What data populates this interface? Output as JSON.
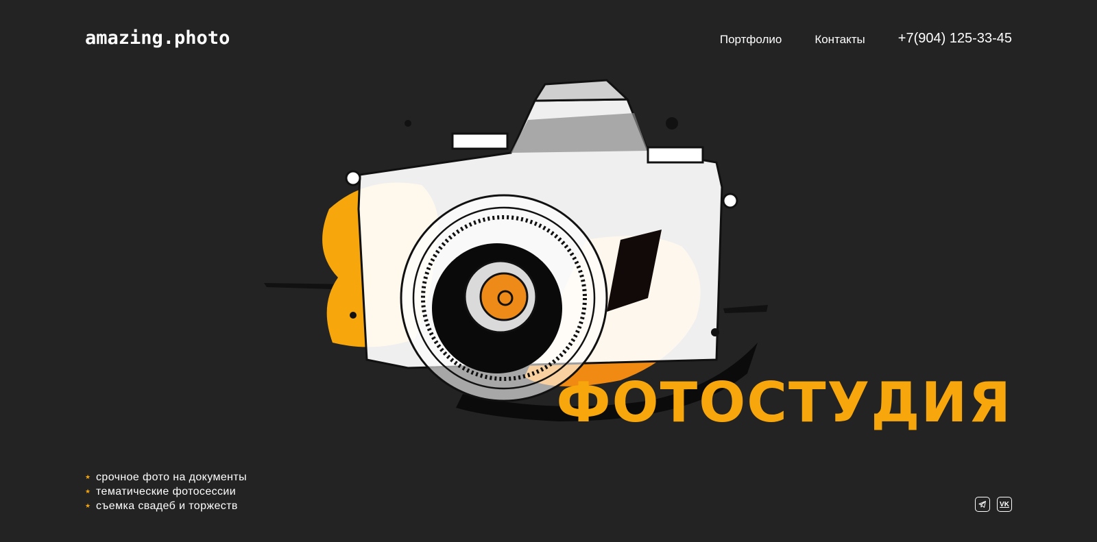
{
  "header": {
    "logo": "amazing.photo",
    "nav": [
      {
        "label": "Портфолио"
      },
      {
        "label": "Контакты"
      }
    ],
    "phone": "+7(904) 125-33-45"
  },
  "hero": {
    "title": "ФОТОСТУДИЯ",
    "illustration_icon": "camera-illustration",
    "accent_color": "#f7a70b",
    "background_color": "#232323"
  },
  "services": [
    "срочное фото на документы",
    "тематические фотосессии",
    "съемка свадеб и торжеств"
  ],
  "socials": [
    {
      "icon": "telegram-icon"
    },
    {
      "icon": "vk-icon",
      "label": "VK"
    }
  ]
}
